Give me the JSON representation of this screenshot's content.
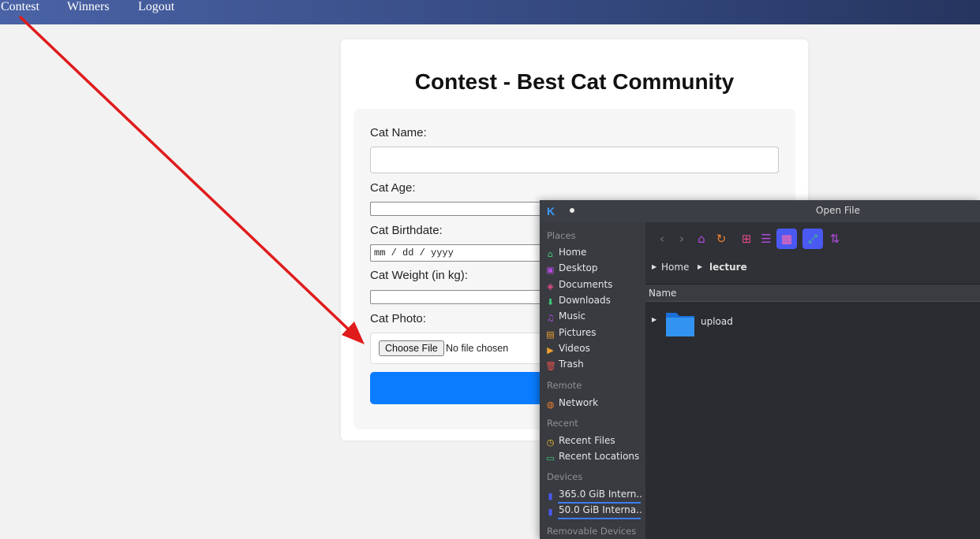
{
  "nav": {
    "items": [
      "Contest",
      "Winners",
      "Logout"
    ]
  },
  "card": {
    "title": "Contest - Best Cat Community",
    "labels": {
      "name": "Cat Name:",
      "age": "Cat Age:",
      "birthdate": "Cat Birthdate:",
      "weight": "Cat Weight (in kg):",
      "photo": "Cat Photo:"
    },
    "birthdate_placeholder": "mm / dd / yyyy",
    "choose_file": "Choose File",
    "no_file": "No file chosen",
    "submit_color": "#0a7cff"
  },
  "annotation": {
    "arrow_color": "#e01b1b"
  },
  "dialog": {
    "title": "Open File",
    "sections": {
      "places": "Places",
      "remote": "Remote",
      "recent": "Recent",
      "devices": "Devices",
      "removable": "Removable Devices"
    },
    "places": [
      {
        "label": "Home",
        "icon": "home-icon"
      },
      {
        "label": "Desktop",
        "icon": "desktop-icon"
      },
      {
        "label": "Documents",
        "icon": "documents-icon"
      },
      {
        "label": "Downloads",
        "icon": "downloads-icon"
      },
      {
        "label": "Music",
        "icon": "music-icon"
      },
      {
        "label": "Pictures",
        "icon": "pictures-icon"
      },
      {
        "label": "Videos",
        "icon": "videos-icon"
      },
      {
        "label": "Trash",
        "icon": "trash-icon"
      }
    ],
    "remote": [
      {
        "label": "Network",
        "icon": "network-icon"
      }
    ],
    "recent": [
      {
        "label": "Recent Files",
        "icon": "recent-files-icon"
      },
      {
        "label": "Recent Locations",
        "icon": "recent-locations-icon"
      }
    ],
    "devices": [
      {
        "label": "365.0 GiB Intern...",
        "icon": "drive-icon"
      },
      {
        "label": "50.0 GiB Interna...",
        "icon": "drive-icon"
      }
    ],
    "breadcrumb": {
      "home": "Home",
      "current": "lecture"
    },
    "column_name": "Name",
    "files": [
      {
        "name": "upload",
        "icon": "folder-icon"
      }
    ],
    "accent": "#4a59f2"
  }
}
